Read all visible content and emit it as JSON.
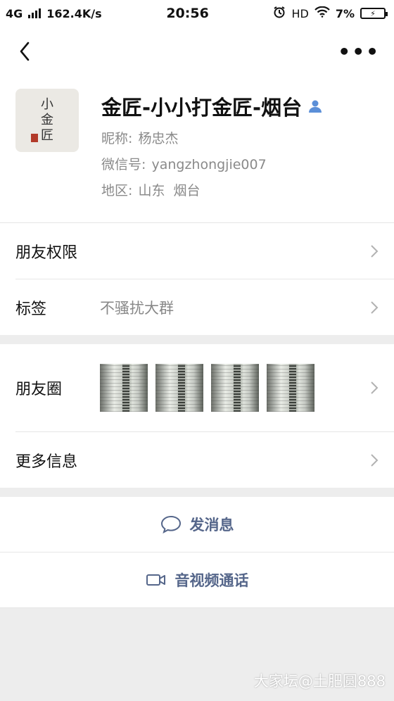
{
  "status_bar": {
    "network": "4G",
    "speed": "162.4K/s",
    "time": "20:56",
    "hd": "HD",
    "battery": "7%"
  },
  "nav": {
    "back_icon": "chevron-left-icon",
    "more_label": "•••"
  },
  "profile": {
    "avatar_text": [
      "小",
      "金",
      "匠"
    ],
    "name": "金匠-小小打金匠-烟台",
    "nickname_label": "昵称:",
    "nickname": "杨忠杰",
    "wechat_label": "微信号:",
    "wechat_id": "yangzhongjie007",
    "region_label": "地区:",
    "region": "山东  烟台"
  },
  "rows": {
    "friend_permissions": "朋友权限",
    "tags_label": "标签",
    "tags_value": "不骚扰大群",
    "moments_label": "朋友圈",
    "more_info": "更多信息"
  },
  "actions": {
    "send_message": "发消息",
    "video_call": "音视频通话"
  },
  "colors": {
    "link_blue": "#55668a",
    "background": "#ededed"
  },
  "watermark": "大家坛@土肥圆888"
}
